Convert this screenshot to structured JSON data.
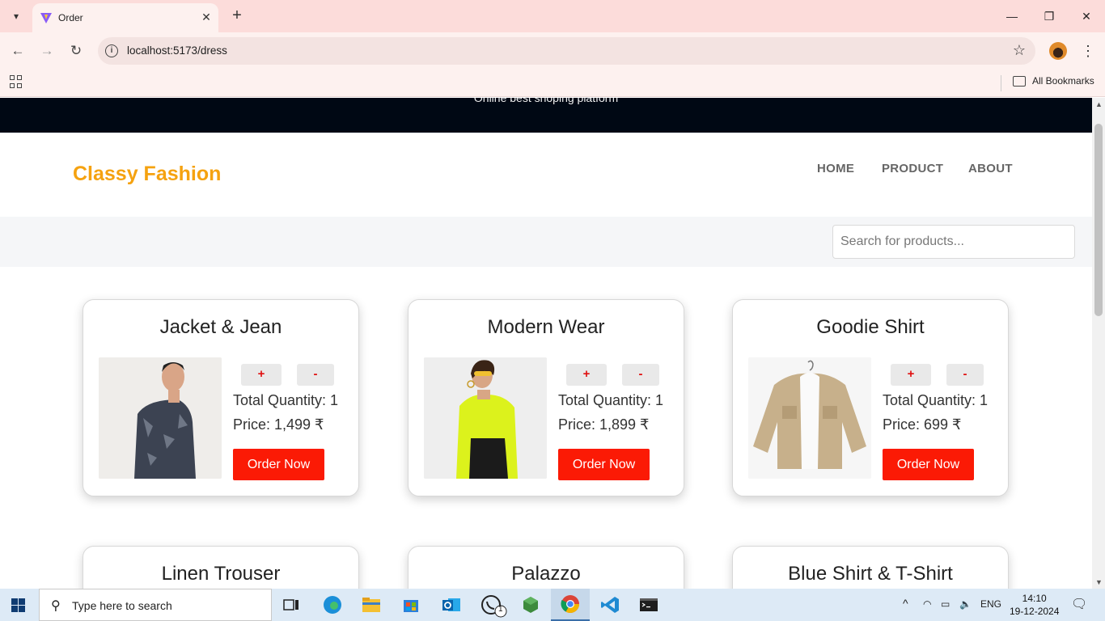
{
  "browser": {
    "tab_title": "Order",
    "url": "localhost:5173/dress",
    "bookmarks_label": "All Bookmarks"
  },
  "page": {
    "tagline": "Online best shoping platform",
    "brand": "Classy Fashion",
    "nav": [
      "HOME",
      "PRODUCT",
      "ABOUT"
    ],
    "search_placeholder": "Search for products...",
    "plus_label": "+",
    "minus_label": "-",
    "order_label": "Order Now",
    "products": [
      {
        "title": "Jacket & Jean",
        "quantity": "Total Quantity: 1",
        "price": "Price: 1,499 ₹",
        "image": "man-camo-jacket"
      },
      {
        "title": "Modern Wear",
        "quantity": "Total Quantity: 1",
        "price": "Price: 1,899 ₹",
        "image": "woman-yellow-jacket"
      },
      {
        "title": "Goodie Shirt",
        "quantity": "Total Quantity: 1",
        "price": "Price: 699 ₹",
        "image": "beige-shirt-hoodie"
      },
      {
        "title": "Linen Trouser"
      },
      {
        "title": "Palazzo"
      },
      {
        "title": "Blue Shirt & T-Shirt"
      }
    ]
  },
  "taskbar": {
    "search_text": "Type here to search",
    "language": "ENG",
    "time": "14:10",
    "date": "19-12-2024",
    "whatsapp_badge": "1"
  },
  "colors": {
    "brand": "#f5a210",
    "order_button": "#fb1a05",
    "topbar": "#000814",
    "tab_strip": "#fcdcda"
  }
}
